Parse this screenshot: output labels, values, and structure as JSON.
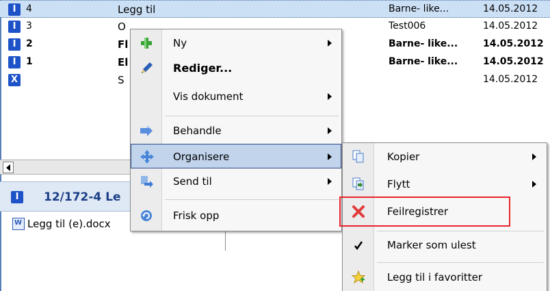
{
  "rows": [
    {
      "num": "4",
      "title": "Legg til",
      "sender": "Barne- like...",
      "date": "14.05.2012",
      "selected": true,
      "bold": false,
      "icon": "I"
    },
    {
      "num": "3",
      "title": "O",
      "sender": "Test006",
      "date": "14.05.2012",
      "selected": false,
      "bold": false,
      "icon": "I"
    },
    {
      "num": "2",
      "title": "Fl",
      "sender": "Barne- like...",
      "date": "14.05.2012",
      "selected": false,
      "bold": true,
      "icon": "I"
    },
    {
      "num": "1",
      "title": "El",
      "sender": "Barne- like...",
      "date": "14.05.2012",
      "selected": false,
      "bold": true,
      "icon": "I"
    },
    {
      "num": "",
      "title": "S",
      "sender": "",
      "date": "14.05.2012",
      "selected": false,
      "bold": false,
      "icon": "X"
    }
  ],
  "case": {
    "icon": "I",
    "title": "12/172-4  Le"
  },
  "document": {
    "label": "Legg til (e).docx"
  },
  "menu1": {
    "items": [
      {
        "label": "Ny",
        "icon": "green-plus-icon"
      },
      {
        "label": "Rediger...",
        "icon": "pencil-icon"
      },
      {
        "label": "Vis dokument",
        "icon": ""
      },
      {
        "label": "Behandle",
        "icon": "process-arrow-icon"
      },
      {
        "label": "Organisere",
        "icon": "move-cross-icon"
      },
      {
        "label": "Send til",
        "icon": "send-to-icon"
      },
      {
        "label": "Frisk opp",
        "icon": "refresh-icon"
      }
    ]
  },
  "menu2": {
    "items": [
      {
        "label": "Kopier",
        "icon": "copy-icon"
      },
      {
        "label": "Flytt",
        "icon": "move-document-icon"
      },
      {
        "label": "Feilregistrer",
        "icon": "red-x-icon"
      },
      {
        "label": "Marker som ulest",
        "icon": "checkmark-icon"
      },
      {
        "label": "Legg til i favoritter",
        "icon": "favorite-star-icon"
      }
    ]
  },
  "colors": {
    "highlight": "#c1d4ec",
    "selected_row": "#cce0f5",
    "annotation": "#e8232a",
    "type_icon": "#1d52c8"
  }
}
